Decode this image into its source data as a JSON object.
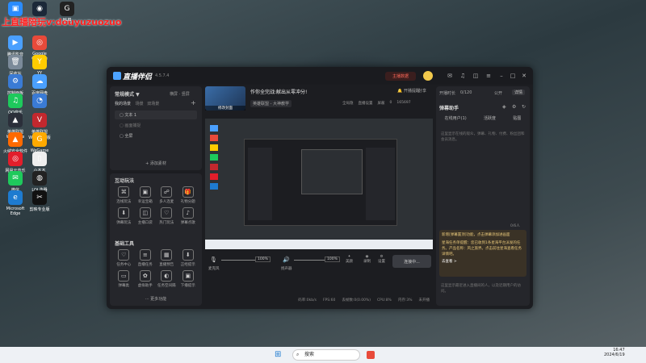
{
  "watermark": "上直播陪玩v:douyuzuozuo",
  "desktop_icons": [
    {
      "label": "",
      "color": "#2a8cff",
      "glyph": "▣"
    },
    {
      "label": "",
      "color": "#1b2838",
      "glyph": "◉"
    },
    {
      "label": "HUB",
      "color": "#222",
      "glyph": "G"
    },
    {
      "label": "腾讯影音",
      "color": "#4aa0ff",
      "glyph": "▶"
    },
    {
      "label": "Google Chrome",
      "color": "#e84a3a",
      "glyph": "◎"
    },
    {
      "label": "回收站",
      "color": "#7b8a99",
      "glyph": "🗑"
    },
    {
      "label": "YY",
      "color": "#ffcc00",
      "glyph": "Y"
    },
    {
      "label": "控制面板",
      "color": "#3a7bd5",
      "glyph": "⚙"
    },
    {
      "label": "百度网盘",
      "color": "#4aa0ff",
      "glyph": "☁"
    },
    {
      "label": "QQ音乐",
      "color": "#1ec95c",
      "glyph": "♫"
    },
    {
      "label": "",
      "color": "#3a7bd5",
      "glyph": "◔"
    },
    {
      "label": "英雄联盟WeGame",
      "color": "#2b2f3a",
      "glyph": "▲"
    },
    {
      "label": "英雄联盟WeGame版",
      "color": "#c2282e",
      "glyph": "V"
    },
    {
      "label": "火绒安全软件",
      "color": "#ff6a00",
      "glyph": "▲"
    },
    {
      "label": "WeGame",
      "color": "#ffaa00",
      "glyph": "G"
    },
    {
      "label": "网易云音乐",
      "color": "#e21e2b",
      "glyph": "◎"
    },
    {
      "label": "小本本",
      "color": "#eee",
      "glyph": "▯"
    },
    {
      "label": "微信",
      "color": "#1ec95c",
      "glyph": "✉"
    },
    {
      "label": "LOL选器",
      "color": "#222",
      "glyph": "◍"
    },
    {
      "label": "Microsoft Edge",
      "color": "#1e7bd0",
      "glyph": "e"
    },
    {
      "label": "剪映专业版",
      "color": "#111",
      "glyph": "✂"
    }
  ],
  "app": {
    "name": "直播伴侣",
    "version": "4.5.7.4",
    "badge": "主播数据",
    "title_icons": [
      "mail-icon",
      "bell-icon",
      "shirt-icon",
      "menu-icon",
      "minimize-icon",
      "maximize-icon",
      "close-icon"
    ]
  },
  "left": {
    "mode": "常规模式 ▼",
    "mode_actions": [
      "横屏",
      "竖屏"
    ],
    "scenes_title": "我的场景",
    "scene_tabs": [
      "场景",
      "双场景"
    ],
    "add_icon": "+",
    "items": [
      "文本 1",
      "画面捕捉",
      "全屏"
    ],
    "add_material": "+ 添加素材",
    "interactive_title": "互动玩法",
    "interactive": [
      {
        "label": "连线玩法",
        "glyph": "⌘"
      },
      {
        "label": "幸运宝箱",
        "glyph": "▣"
      },
      {
        "label": "多人连麦",
        "glyph": "☍"
      },
      {
        "label": "礼物分题",
        "glyph": "🎁"
      },
      {
        "label": "弹幕玩法",
        "glyph": "⬇"
      },
      {
        "label": "主播口袋",
        "glyph": "◫"
      },
      {
        "label": "热门玩法",
        "glyph": "♡"
      },
      {
        "label": "弹幕点歌",
        "glyph": "♪"
      }
    ],
    "tools_title": "基础工具",
    "tools": [
      {
        "label": "任务中心",
        "glyph": "♡"
      },
      {
        "label": "直播任务",
        "glyph": "≡"
      },
      {
        "label": "直播预告",
        "glyph": "▦"
      },
      {
        "label": "正经提示",
        "glyph": "⬇"
      },
      {
        "label": "弹幕类",
        "glyph": "▭"
      },
      {
        "label": "虚拟助手",
        "glyph": "✿"
      },
      {
        "label": "任务空间隔",
        "glyph": "◐"
      },
      {
        "label": "下播提示",
        "glyph": "▣"
      }
    ],
    "more": "··· 更多功能"
  },
  "center": {
    "cover_label": "修改封面",
    "stream_title": "作你全完战:献出从零冲分!",
    "start_hint": "开播提醒",
    "share": "分享",
    "category": "英雄联盟 - 大神教学",
    "stats": [
      "全局隐",
      "直播设置",
      "屏蔽",
      "0",
      "165697"
    ],
    "mic_label": "麦克风",
    "mic_volume": "100%",
    "speaker_label": "扬声器",
    "speaker_volume": "100%",
    "beauty": "美颜",
    "record": "录制",
    "settings": "设置",
    "go_live": "连接中...",
    "statusbar": [
      "码率:0kb/s",
      "FPS:60",
      "丢帧数:0(0.00%)",
      "CPU:8%",
      "内存:3%",
      "未开播"
    ]
  },
  "right": {
    "live_time_label": "开播时长",
    "counter": "0/120",
    "mode": "公开",
    "profile": "详情",
    "danmaku_title": "弹幕助手",
    "tabs": [
      "在线用户(1)",
      "活跃度",
      "贴图"
    ],
    "hint": "这里显示在线的观众，弹幕、礼物、付费、粉丝团和会员消息。",
    "popup_counter": "0/6人",
    "notice_text": "新增[弹幕置顶]功能，点击弹幕添加进画面",
    "task_text": "星海任务单提醒：您已收到1条星海平台派发的任务。产品名称：风之旅界。点击前往星海查看任务详情吧。",
    "task_link": "去查看 >",
    "footer": "这里显示最近进入直播间的人，以及近期用户的访问。"
  },
  "taskbar": {
    "search_placeholder": "搜索",
    "time": "16:47",
    "date": "2024/6/19"
  }
}
